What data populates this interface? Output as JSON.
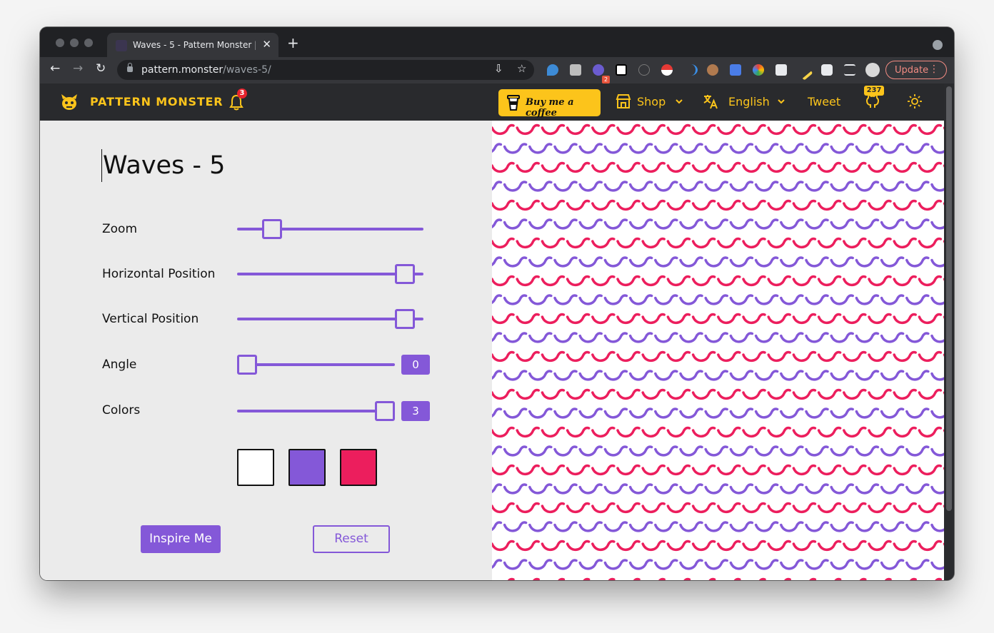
{
  "browser": {
    "tab_title": "Waves - 5 - Pattern Monster | S",
    "url_host": "pattern.monster",
    "url_path": "/waves-5/",
    "extension_badge": "2",
    "update_label": "Update"
  },
  "header": {
    "brand": "PATTERN MONSTER",
    "notification_count": "3",
    "coffee_label": "Buy me a coffee",
    "shop_label": "Shop",
    "language_label": "English",
    "tweet_label": "Tweet",
    "github_stars": "237"
  },
  "pattern": {
    "title": "Waves - 5",
    "controls": {
      "zoom": {
        "label": "Zoom",
        "value": 0.15
      },
      "horizontal": {
        "label": "Horizontal Position",
        "value": 0.95
      },
      "vertical": {
        "label": "Vertical Position",
        "value": 0.95
      },
      "angle": {
        "label": "Angle",
        "value": "0"
      },
      "colors": {
        "label": "Colors",
        "value": "3"
      }
    },
    "swatches": [
      "#ffffff",
      "#8458d8",
      "#ec1e5d"
    ],
    "inspire_label": "Inspire Me",
    "reset_label": "Reset"
  },
  "colors": {
    "accent": "#8458d8",
    "brand_yellow": "#fcc41b",
    "wave_pink": "#ec1e5d",
    "wave_purple": "#8458d8"
  }
}
